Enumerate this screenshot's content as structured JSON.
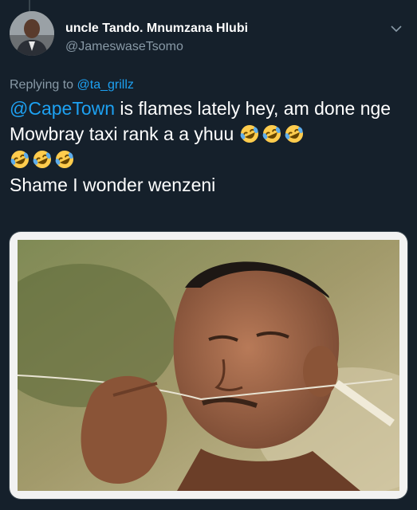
{
  "tweet": {
    "display_name": "uncle Tando. Mnumzana Hlubi",
    "handle": "@JameswaseTsomo",
    "replying_prefix": "Replying to",
    "replying_to": "@ta_grillz",
    "text_mention": "@CapeTown",
    "text_line1_rest": " is flames lately hey, am done nge Mowbray taxi rank a a yhuu ",
    "text_line3": "Shame I wonder wenzeni",
    "emojis": [
      "rolling-on-floor-laughing",
      "rolling-on-floor-laughing",
      "rolling-on-floor-laughing",
      "rolling-on-floor-laughing",
      "rolling-on-floor-laughing",
      "rolling-on-floor-laughing"
    ]
  },
  "icons": {
    "menu": "chevron-down-icon",
    "avatar": "avatar"
  },
  "colors": {
    "background": "#15202b",
    "accent": "#1da1f2",
    "secondary_text": "#8899a6",
    "primary_text": "#ffffff"
  }
}
